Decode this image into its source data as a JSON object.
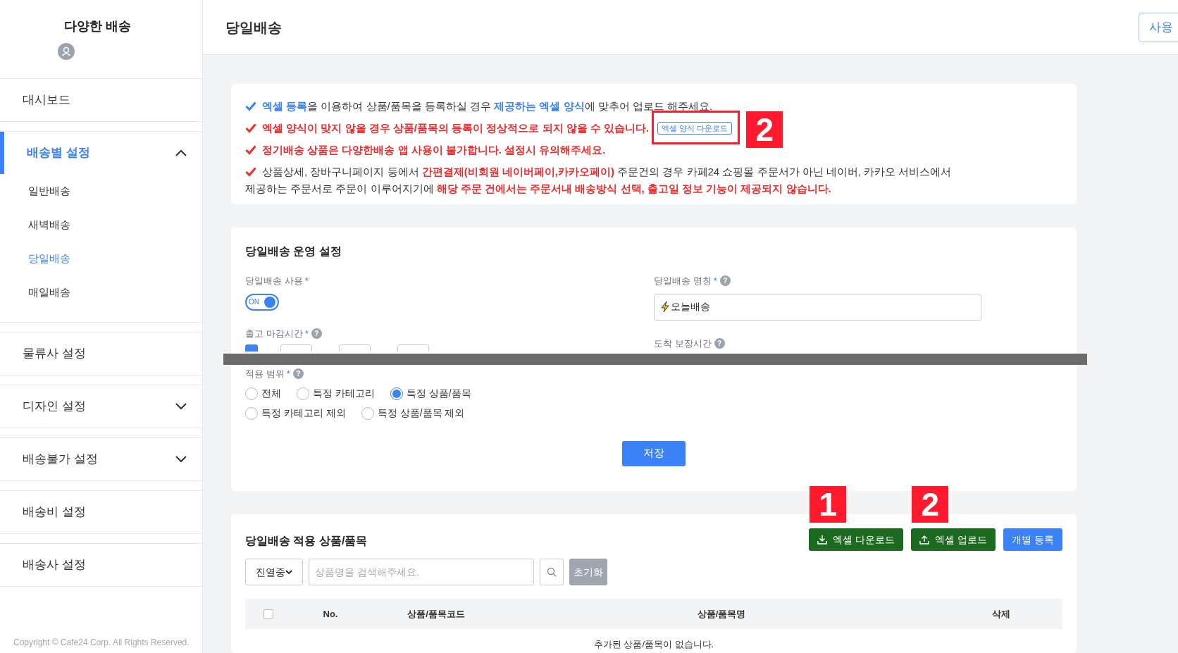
{
  "sidebar": {
    "title": "다양한 배송",
    "items": [
      {
        "label": "대시보드",
        "selected": false
      },
      {
        "label": "배송별 설정",
        "selected": true,
        "expanded": true,
        "children": [
          {
            "label": "일반배송",
            "selected": false
          },
          {
            "label": "새벽배송",
            "selected": false
          },
          {
            "label": "당일배송",
            "selected": true
          },
          {
            "label": "매일배송",
            "selected": false
          }
        ]
      },
      {
        "label": "물류사 설정",
        "selected": false
      },
      {
        "label": "디자인 설정",
        "selected": false,
        "expanded": false
      },
      {
        "label": "배송불가 설정",
        "selected": false,
        "expanded": false
      },
      {
        "label": "배송비 설정",
        "selected": false
      },
      {
        "label": "배송사 설정",
        "selected": false
      }
    ],
    "copyright": "Copyright © Cafe24 Corp. All Rights Reserved."
  },
  "header": {
    "title": "당일배송",
    "button": "사용"
  },
  "notices": [
    {
      "color": "#3b82f6",
      "segments": [
        {
          "kind": "blue",
          "text": "엑셀 등록"
        },
        {
          "kind": "plain",
          "text": "을 이용하여 상품/품목을 등록하실 경우 "
        },
        {
          "kind": "blue",
          "text": "제공하는 엑셀 양식"
        },
        {
          "kind": "plain",
          "text": "에 맞추어 업로드 해주세요."
        }
      ]
    },
    {
      "color": "#ef2b2b",
      "segments": [
        {
          "kind": "red",
          "text": "엑셀 양식이 맞지 않을 경우 상품/품목의 등록이 정상적으로 되지 않을 수 있습니다."
        }
      ],
      "link": "엑셀 양식 다운로드",
      "badge": "2"
    },
    {
      "color": "#ef2b2b",
      "segments": [
        {
          "kind": "red",
          "text": "정기배송 상품은 다양한배송 앱 사용이 불가합니다. 설정시 유의해주세요."
        }
      ]
    },
    {
      "color": "#ef2b2b",
      "segments": [
        {
          "kind": "plain",
          "text": "상품상세, 장바구니페이지 등에서 "
        },
        {
          "kind": "red",
          "text": "간편결제(비회원 네이버페이,카카오페이)"
        },
        {
          "kind": "plain",
          "text": " 주문건의 경우 카페24 쇼핑몰 주문서가 아닌 네이버, 카카오 서비스에서 제공하는 주문서로 주문이 이루어지기에 "
        },
        {
          "kind": "red",
          "text": "해당 주문 건에서는 주문서내 배송방식 선택, 출고일 정보 기능이 제공되지 않습니다."
        }
      ]
    }
  ],
  "settings": {
    "title": "당일배송 운영 설정",
    "use": {
      "label": "당일배송 사용",
      "required": "*",
      "toggle": "ON",
      "on": true
    },
    "name": {
      "label": "당일배송 명칭",
      "required": "*",
      "help": "?",
      "value": "오늘배송"
    },
    "cutoff": {
      "label": "출고 마감시간",
      "required": "*",
      "help": "?",
      "checked": true
    },
    "arrival": {
      "label": "도착 보장시간",
      "help": "?"
    },
    "scope": {
      "label": "적용 범위",
      "required": "*",
      "help": "?",
      "options": [
        {
          "label": "전체",
          "selected": false
        },
        {
          "label": "특정 카테고리",
          "selected": false
        },
        {
          "label": "특정 상품/품목",
          "selected": true
        },
        {
          "label": "특정 카테고리 제외",
          "selected": false
        },
        {
          "label": "특정 상품/품목 제외",
          "selected": false
        }
      ]
    },
    "save": "저장"
  },
  "products": {
    "title": "당일배송 적용 상품/품목",
    "buttons": [
      {
        "kind": "download",
        "label": "엑셀 다운로드",
        "badge": "1"
      },
      {
        "kind": "upload",
        "label": "엑셀 업로드",
        "badge": "2"
      },
      {
        "kind": "primary",
        "label": "개별 등록"
      }
    ],
    "filter": "진열중",
    "search_placeholder": "상품명을 검색해주세요.",
    "reset": "초기화",
    "table": {
      "all_checked": false,
      "columns": [
        "No.",
        "상품/품목코드",
        "상품/품목명",
        "삭제"
      ],
      "empty": "추가된 상품/품목이 없습니다."
    }
  }
}
